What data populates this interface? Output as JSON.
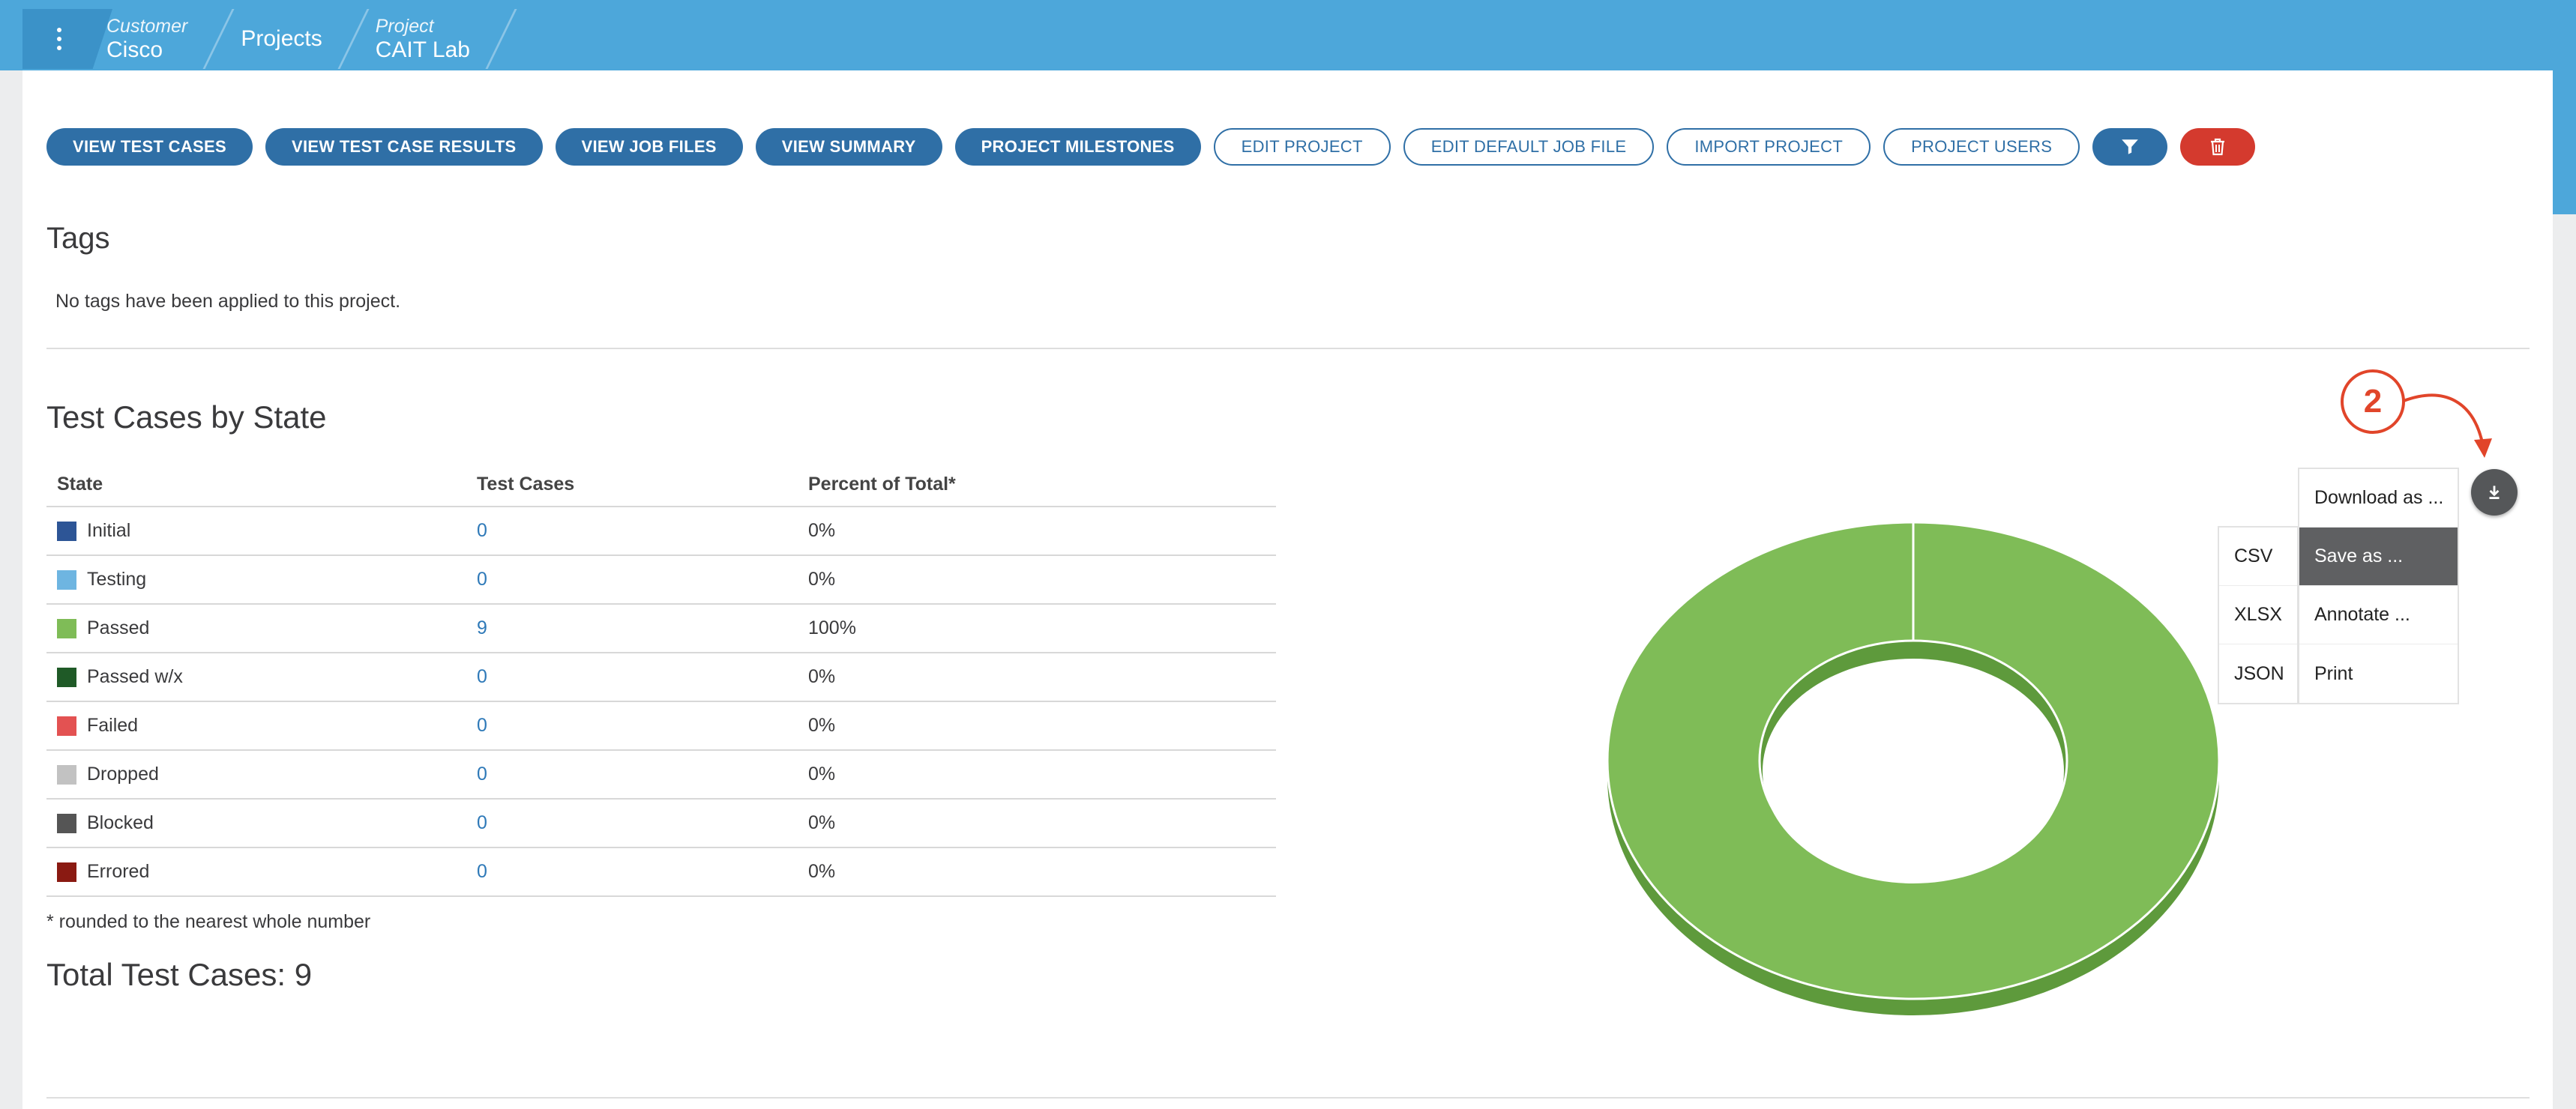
{
  "breadcrumb": {
    "customer_label": "Customer",
    "customer_value": "Cisco",
    "projects_label": "Projects",
    "project_label": "Project",
    "project_value": "CAIT Lab"
  },
  "toolbar": {
    "view_test_cases": "VIEW TEST CASES",
    "view_test_case_results": "VIEW TEST CASE RESULTS",
    "view_job_files": "VIEW JOB FILES",
    "view_summary": "VIEW SUMMARY",
    "project_milestones": "PROJECT MILESTONES",
    "edit_project": "EDIT PROJECT",
    "edit_default_job_file": "EDIT DEFAULT JOB FILE",
    "import_project": "IMPORT PROJECT",
    "project_users": "PROJECT USERS",
    "filter_icon": "filter-icon",
    "delete_icon": "trash-icon"
  },
  "tags": {
    "title": "Tags",
    "empty_text": "No tags have been applied to this project."
  },
  "state_section": {
    "title": "Test Cases by State",
    "headers": [
      "State",
      "Test Cases",
      "Percent of Total*"
    ],
    "rows": [
      {
        "state": "Initial",
        "count": "0",
        "percent": "0%",
        "color": "#2d5596"
      },
      {
        "state": "Testing",
        "count": "0",
        "percent": "0%",
        "color": "#6eb5e1"
      },
      {
        "state": "Passed",
        "count": "9",
        "percent": "100%",
        "color": "#7fbc57"
      },
      {
        "state": "Passed w/x",
        "count": "0",
        "percent": "0%",
        "color": "#1f5a27"
      },
      {
        "state": "Failed",
        "count": "0",
        "percent": "0%",
        "color": "#e35252"
      },
      {
        "state": "Dropped",
        "count": "0",
        "percent": "0%",
        "color": "#c2c2c2"
      },
      {
        "state": "Blocked",
        "count": "0",
        "percent": "0%",
        "color": "#555555"
      },
      {
        "state": "Errored",
        "count": "0",
        "percent": "0%",
        "color": "#8a1a12"
      }
    ],
    "footnote": "* rounded to the nearest whole number",
    "total": "Total Test Cases: 9"
  },
  "chart_data": {
    "type": "pie",
    "categories": [
      "Initial",
      "Testing",
      "Passed",
      "Passed w/x",
      "Failed",
      "Dropped",
      "Blocked",
      "Errored"
    ],
    "values": [
      0,
      0,
      9,
      0,
      0,
      0,
      0,
      0
    ],
    "donut": true,
    "three_d": true,
    "colors": {
      "Passed": "#7fbc57",
      "Passed_side": "#5e9a3c"
    },
    "legend": "none"
  },
  "annotation": {
    "number": "2",
    "color": "#e1452a"
  },
  "download_button_icon": "download-icon",
  "export_menu": {
    "items": [
      "Download as ...",
      "Save as ...",
      "Annotate ...",
      "Print"
    ],
    "active_item": "Save as ...",
    "submenu": [
      "CSV",
      "XLSX",
      "JSON"
    ]
  }
}
